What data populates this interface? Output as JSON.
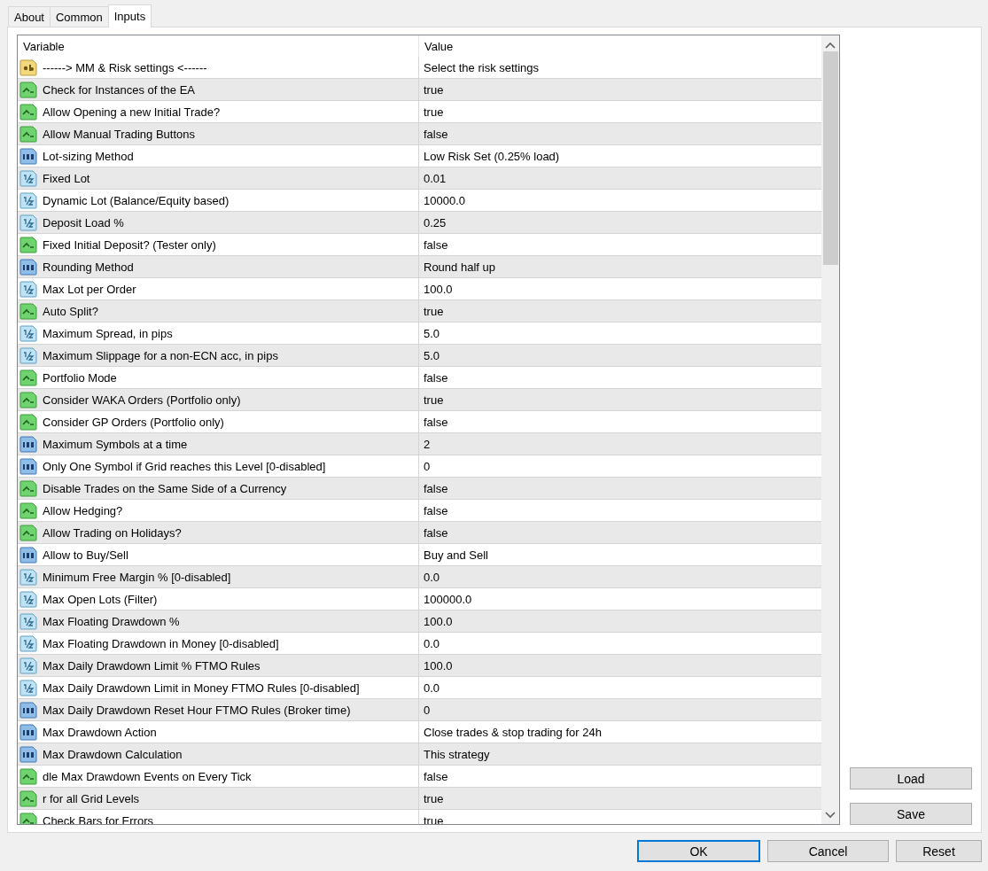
{
  "tabs": [
    {
      "label": "About",
      "selected": false
    },
    {
      "label": "Common",
      "selected": false
    },
    {
      "label": "Inputs",
      "selected": true
    }
  ],
  "table": {
    "columns": [
      "Variable",
      "Value"
    ],
    "rows": [
      {
        "kind": "string",
        "variable": "------> MM & Risk settings <------",
        "value": "Select the risk settings"
      },
      {
        "kind": "bool",
        "variable": "Check for Instances of the EA",
        "value": "true"
      },
      {
        "kind": "bool",
        "variable": "Allow Opening a new Initial Trade?",
        "value": "true"
      },
      {
        "kind": "bool",
        "variable": "Allow Manual Trading Buttons",
        "value": "false"
      },
      {
        "kind": "enum",
        "variable": "Lot-sizing Method",
        "value": "Low Risk Set (0.25% load)"
      },
      {
        "kind": "double",
        "variable": "Fixed Lot",
        "value": "0.01"
      },
      {
        "kind": "double",
        "variable": "Dynamic Lot (Balance/Equity based)",
        "value": "10000.0"
      },
      {
        "kind": "double",
        "variable": "Deposit Load %",
        "value": "0.25"
      },
      {
        "kind": "bool",
        "variable": "Fixed Initial Deposit? (Tester only)",
        "value": "false"
      },
      {
        "kind": "enum",
        "variable": "Rounding Method",
        "value": "Round half up"
      },
      {
        "kind": "double",
        "variable": "Max Lot per Order",
        "value": "100.0"
      },
      {
        "kind": "bool",
        "variable": "Auto Split?",
        "value": "true"
      },
      {
        "kind": "double",
        "variable": "Maximum Spread, in pips",
        "value": "5.0"
      },
      {
        "kind": "double",
        "variable": "Maximum Slippage for a non-ECN acc, in pips",
        "value": "5.0"
      },
      {
        "kind": "bool",
        "variable": "Portfolio Mode",
        "value": "false"
      },
      {
        "kind": "bool",
        "variable": "Consider WAKA Orders (Portfolio only)",
        "value": "true"
      },
      {
        "kind": "bool",
        "variable": "Consider GP Orders (Portfolio only)",
        "value": "false"
      },
      {
        "kind": "enum",
        "variable": "Maximum Symbols at a time",
        "value": "2"
      },
      {
        "kind": "enum",
        "variable": "Only One Symbol if Grid reaches this Level [0-disabled]",
        "value": "0"
      },
      {
        "kind": "bool",
        "variable": "Disable Trades on the Same Side of a Currency",
        "value": "false"
      },
      {
        "kind": "bool",
        "variable": "Allow Hedging?",
        "value": "false"
      },
      {
        "kind": "bool",
        "variable": "Allow Trading on Holidays?",
        "value": "false"
      },
      {
        "kind": "enum",
        "variable": "Allow to Buy/Sell",
        "value": "Buy and Sell"
      },
      {
        "kind": "double",
        "variable": "Minimum Free Margin % [0-disabled]",
        "value": "0.0"
      },
      {
        "kind": "double",
        "variable": "Max Open Lots (Filter)",
        "value": "100000.0"
      },
      {
        "kind": "double",
        "variable": "Max Floating Drawdown %",
        "value": "100.0"
      },
      {
        "kind": "double",
        "variable": "Max Floating Drawdown in Money [0-disabled]",
        "value": "0.0"
      },
      {
        "kind": "double",
        "variable": "Max Daily Drawdown Limit % FTMO Rules",
        "value": "100.0"
      },
      {
        "kind": "double",
        "variable": "Max Daily Drawdown Limit in Money FTMO Rules [0-disabled]",
        "value": "0.0"
      },
      {
        "kind": "enum",
        "variable": "Max Daily Drawdown Reset Hour FTMO Rules (Broker time)",
        "value": "0"
      },
      {
        "kind": "enum",
        "variable": "Max Drawdown Action",
        "value": "Close trades & stop trading for 24h"
      },
      {
        "kind": "enum",
        "variable": "Max Drawdown Calculation",
        "value": "This strategy"
      },
      {
        "kind": "bool",
        "variable": "dle Max Drawdown Events on Every Tick",
        "value": "false"
      },
      {
        "kind": "bool",
        "variable": "r for all Grid Levels",
        "value": "true"
      },
      {
        "kind": "bool",
        "variable": "Check Bars for Errors",
        "value": "true"
      }
    ]
  },
  "side_buttons": [
    "Load",
    "Save"
  ],
  "buttons": [
    {
      "label": "OK",
      "default": true
    },
    {
      "label": "Cancel",
      "default": false
    },
    {
      "label": "Reset",
      "default": false
    }
  ]
}
